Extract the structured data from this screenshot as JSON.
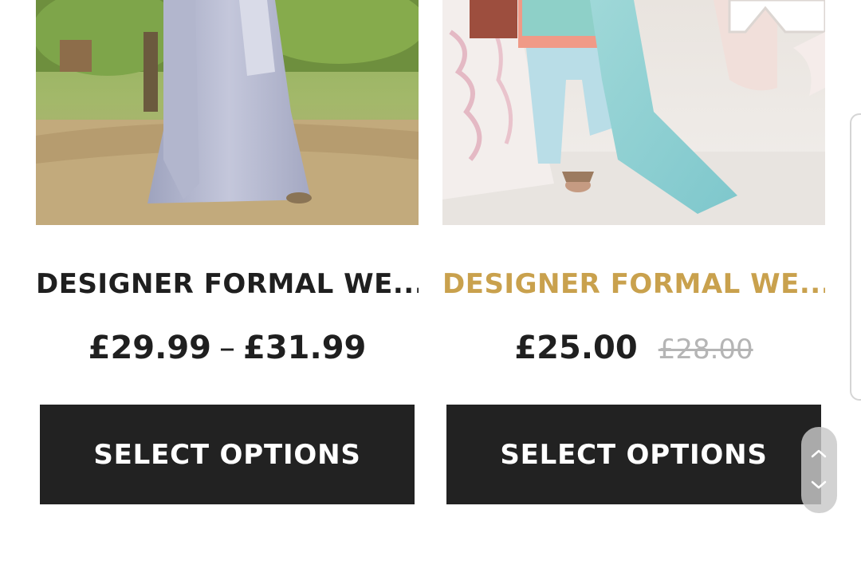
{
  "products": [
    {
      "title": "DESIGNER FORMAL WE...",
      "price_from": "£29.99",
      "price_separator": "–",
      "price_to": "£31.99",
      "button_label": "SELECT OPTIONS",
      "image_icon": "product-photo-lavender-dress"
    },
    {
      "title": "DESIGNER FORMAL WE...",
      "price_sale": "£25.00",
      "price_regular": "£28.00",
      "button_label": "SELECT OPTIONS",
      "image_icon": "product-photo-mint-suit"
    }
  ],
  "colors": {
    "title_default": "#1f1f1f",
    "title_highlight": "#c9a14d",
    "button_bg": "#222222",
    "button_text": "#ffffff",
    "price_old": "#b5b5b5"
  },
  "scroll_widget": {
    "up_icon": "chevron-up-icon",
    "down_icon": "chevron-down-icon"
  }
}
